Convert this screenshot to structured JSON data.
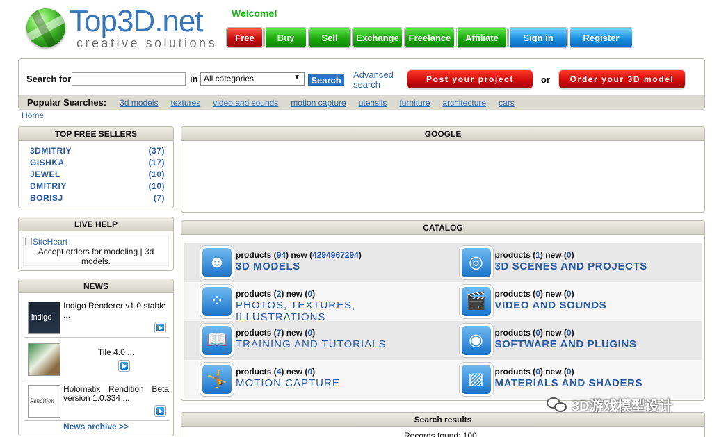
{
  "brand": {
    "name": "Top3D.net",
    "tagline": "creative solutions"
  },
  "welcome": "Welcome!",
  "nav": [
    {
      "label": "Free",
      "color": "red",
      "w": 52
    },
    {
      "label": "Buy",
      "color": "green",
      "w": 60
    },
    {
      "label": "Sell",
      "color": "green",
      "w": 60
    },
    {
      "label": "Exchange",
      "color": "green",
      "w": 72
    },
    {
      "label": "Freelance",
      "color": "green",
      "w": 72
    },
    {
      "label": "Affiliate",
      "color": "green",
      "w": 72
    },
    {
      "label": "Sign in",
      "color": "blue",
      "w": 84
    },
    {
      "label": "Register",
      "color": "blue",
      "w": 91
    }
  ],
  "search": {
    "label": "Search for",
    "value": "",
    "in_label": "in",
    "category_selected": "All categories",
    "button": "Search",
    "advanced": "Advanced search",
    "post_project": "Post your project",
    "or": "or",
    "order_model": "Order your 3D model"
  },
  "popular": {
    "label": "Popular Searches:",
    "items": [
      "3d models",
      "textures",
      "video and sounds",
      "motion capture",
      "utensils",
      "furniture",
      "architecture",
      "cars"
    ]
  },
  "breadcrumb": "Home",
  "top_sellers": {
    "title": "TOP FREE SELLERS",
    "items": [
      {
        "name": "3DMITRIY",
        "count": "(37)"
      },
      {
        "name": "GISHKA",
        "count": "(17)"
      },
      {
        "name": "JEWEL",
        "count": "(10)"
      },
      {
        "name": "DMITRIY",
        "count": "(10)"
      },
      {
        "name": "BORISJ",
        "count": "(7)"
      }
    ]
  },
  "live_help": {
    "title": "LIVE HELP",
    "image_alt": "SiteHeart",
    "text": "Accept orders for modeling | 3d models."
  },
  "news": {
    "title": "NEWS",
    "items": [
      {
        "text": "Indigo Renderer v1.0 stable ...",
        "thumb_label": "indigo"
      },
      {
        "text": "Tile 4.0 ..."
      },
      {
        "text": "Holomatix Rendition Beta version 1.0.334 ...",
        "thumb_label": "Rendition"
      }
    ],
    "archive": "News archive >>"
  },
  "google": {
    "title": "GOOGLE"
  },
  "catalog": {
    "title": "CATALOG",
    "items": [
      {
        "products": "94",
        "new": "4294967294",
        "title": "3D MODELS",
        "icon": "3d-models-icon",
        "glyph": "☻"
      },
      {
        "products": "1",
        "new": "0",
        "title": "3D SCENES AND PROJECTS",
        "icon": "3d-scenes-icon",
        "glyph": "◎"
      },
      {
        "products": "2",
        "new": "0",
        "title": "PHOTOS, TEXTURES, ILLUSTRATIONS",
        "icon": "textures-icon",
        "glyph": "⁘"
      },
      {
        "products": "0",
        "new": "0",
        "title": "VIDEO AND SOUNDS",
        "icon": "video-icon",
        "glyph": "🎬"
      },
      {
        "products": "7",
        "new": "0",
        "title": "TRAINING AND TUTORIALS",
        "icon": "tutorials-icon",
        "glyph": "📖"
      },
      {
        "products": "0",
        "new": "0",
        "title": "SOFTWARE AND PLUGINS",
        "icon": "software-icon",
        "glyph": "◉"
      },
      {
        "products": "4",
        "new": "0",
        "title": "MOTION CAPTURE",
        "icon": "motion-capture-icon",
        "glyph": "🤸"
      },
      {
        "products": "0",
        "new": "0",
        "title": "MATERIALS AND SHADERS",
        "icon": "materials-icon",
        "glyph": "▨"
      }
    ],
    "products_label": "products",
    "new_label": "new"
  },
  "results": {
    "title": "Search results",
    "subtext": "Records found: 100"
  },
  "watermark": "3D游戏模型设计"
}
